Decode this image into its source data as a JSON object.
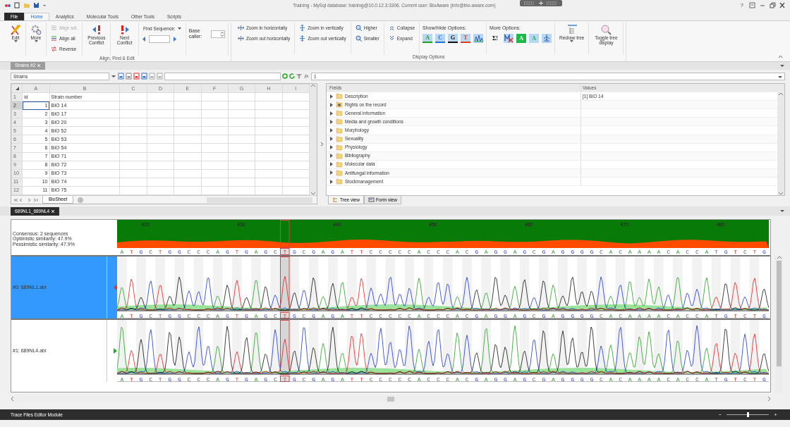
{
  "window": {
    "title": "Training - MySql database: training@10.0.12.3:3306. Current user: BioAware (info@bio-aware.com)",
    "help": "?"
  },
  "ribbon_tabs": [
    {
      "label": "File",
      "kind": "backstage",
      "selected": false
    },
    {
      "label": "Home",
      "kind": "tab",
      "selected": true
    },
    {
      "label": "Analytics",
      "kind": "tab",
      "selected": false
    },
    {
      "label": "Molecular Tools",
      "kind": "tab",
      "selected": false
    },
    {
      "label": "Other Tools",
      "kind": "tab",
      "selected": false
    },
    {
      "label": "Scripts",
      "kind": "tab",
      "selected": false
    }
  ],
  "ribbon": {
    "groups": [
      {
        "label": "Align, Find & Edit",
        "columns": [
          {
            "kind": "large",
            "label": "Edit",
            "menu": true
          },
          {
            "kind": "large",
            "label": "More",
            "menu": true
          },
          {
            "kind": "stack",
            "items": [
              {
                "label": "Align sel.",
                "disabled": true
              },
              {
                "label": "Align all",
                "disabled": false
              },
              {
                "label": "Reverse",
                "disabled": false
              }
            ]
          },
          {
            "kind": "large",
            "label": "Previous Conflict",
            "menu": false
          },
          {
            "kind": "large",
            "label": "Next Conflict",
            "menu": false
          },
          {
            "kind": "find",
            "label": "Find Sequence:"
          },
          {
            "kind": "spin",
            "label": "Base caller:"
          }
        ]
      },
      {
        "label": "Display Options",
        "columns": [
          {
            "kind": "stack",
            "items": [
              {
                "label": "Zoom in horizontally",
                "disabled": false
              },
              {
                "label": "Zoom out horizontally",
                "disabled": false
              }
            ]
          },
          {
            "kind": "stack",
            "items": [
              {
                "label": "Zoom in vertically",
                "disabled": false
              },
              {
                "label": "Zoom out vertically",
                "disabled": false
              }
            ]
          },
          {
            "kind": "stack",
            "items": [
              {
                "label": "Higher",
                "disabled": false
              },
              {
                "label": "Smaller",
                "disabled": false
              }
            ]
          },
          {
            "kind": "stack",
            "items": [
              {
                "label": "Collapse",
                "disabled": false
              },
              {
                "label": "Expand",
                "disabled": false
              }
            ]
          },
          {
            "kind": "toggles",
            "label": "Show/Hide Options:",
            "items": [
              {
                "kind": "letter",
                "label": "A",
                "color": "#22a022",
                "on": true
              },
              {
                "kind": "letter",
                "label": "C",
                "color": "#1e6fd9",
                "on": true
              },
              {
                "kind": "letter",
                "label": "G",
                "color": "#111111",
                "on": true
              },
              {
                "kind": "letter",
                "label": "T",
                "color": "#e0401a",
                "on": true
              },
              {
                "kind": "icon",
                "on": true
              }
            ]
          },
          {
            "kind": "toggles",
            "label": "More Options:",
            "items": [
              {
                "kind": "text",
                "label": "Σ!",
                "on": false
              },
              {
                "kind": "icon",
                "on": true
              },
              {
                "kind": "boxed",
                "label": "A",
                "on": false
              },
              {
                "kind": "tinted",
                "label": "A",
                "on": true
              },
              {
                "kind": "icon",
                "on": true
              }
            ]
          },
          {
            "kind": "large",
            "label": "Redraw tree",
            "menu": true
          },
          {
            "kind": "large",
            "label": "Toggle tree display",
            "menu": false
          }
        ]
      }
    ]
  },
  "sheet": {
    "tab": "Strains #2",
    "name_box": "Strains",
    "formula_label": "fx",
    "formula": "1",
    "columns": [
      "A",
      "B",
      "C",
      "D",
      "E",
      "F",
      "G",
      "H",
      "I"
    ],
    "rows": [
      {
        "number": "1",
        "kind": "header",
        "selected": false,
        "cells": [
          "id",
          "Strain number"
        ]
      },
      {
        "number": "2",
        "kind": "data",
        "selected": true,
        "cells": [
          "1",
          "BIO 14"
        ]
      },
      {
        "number": "3",
        "kind": "data",
        "selected": false,
        "cells": [
          "2",
          "BIO 17"
        ]
      },
      {
        "number": "4",
        "kind": "data",
        "selected": false,
        "cells": [
          "3",
          "BIO 20"
        ]
      },
      {
        "number": "5",
        "kind": "data",
        "selected": false,
        "cells": [
          "4",
          "BIO 52"
        ]
      },
      {
        "number": "6",
        "kind": "data",
        "selected": false,
        "cells": [
          "5",
          "BIO 53"
        ]
      },
      {
        "number": "7",
        "kind": "data",
        "selected": false,
        "cells": [
          "6",
          "BIO 54"
        ]
      },
      {
        "number": "8",
        "kind": "data",
        "selected": false,
        "cells": [
          "7",
          "BIO 71"
        ]
      },
      {
        "number": "9",
        "kind": "data",
        "selected": false,
        "cells": [
          "8",
          "BIO 72"
        ]
      },
      {
        "number": "10",
        "kind": "data",
        "selected": false,
        "cells": [
          "9",
          "BIO 73"
        ]
      },
      {
        "number": "11",
        "kind": "data",
        "selected": false,
        "cells": [
          "10",
          "BIO 74"
        ]
      },
      {
        "number": "12",
        "kind": "data",
        "selected": false,
        "cells": [
          "11",
          "BIO 75"
        ]
      }
    ],
    "sheet_tabs": [
      {
        "label": "BioSheet",
        "selected": true
      }
    ]
  },
  "fields": {
    "columns": [
      "Fields",
      "Values"
    ],
    "items": [
      {
        "name": "Description",
        "value": "[1] BIO 14",
        "kind": "folder",
        "expanded": false
      },
      {
        "name": "Rights on the record",
        "kind": "locked",
        "expanded": false
      },
      {
        "name": "General information",
        "kind": "folder",
        "expanded": false
      },
      {
        "name": "Media and growth conditions",
        "kind": "folder",
        "expanded": false
      },
      {
        "name": "Morphology",
        "kind": "folder",
        "expanded": false
      },
      {
        "name": "Sexuality",
        "kind": "folder",
        "expanded": false
      },
      {
        "name": "Physiology",
        "kind": "folder",
        "expanded": false
      },
      {
        "name": "Bibliography",
        "kind": "folder",
        "expanded": false
      },
      {
        "name": "Molecular data",
        "kind": "folder",
        "expanded": false
      },
      {
        "name": "Antifungal information",
        "kind": "folder",
        "expanded": false
      },
      {
        "name": "Stockmanagement",
        "kind": "folder",
        "expanded": false
      }
    ],
    "views": [
      {
        "label": "Tree view",
        "selected": true
      },
      {
        "label": "Form view",
        "selected": false
      }
    ]
  },
  "trace": {
    "tab": "689NL1_689NL4",
    "consensus": {
      "lines": [
        "Consensus: 2 sequences",
        "Optimistic similarity: 47.9%",
        "Pessimistic similarity: 47.9%"
      ],
      "ticks": [
        "420",
        "430",
        "440",
        "450",
        "460",
        "470",
        "480"
      ],
      "bases_before": "A T G C T G G C C C A G T G A G C",
      "marked": "T",
      "bases_after": "G C G A G A T T C C C C C A C C C A C G A G G A G C G A G G G G C A C A A A A C A C C A T G T C T G"
    },
    "tracks": [
      {
        "name": "#0: 689NL1.abi",
        "selected": true,
        "kind": "reverse",
        "bases_before": "A T G C T G G C C C A G T G A G C",
        "marked": "T",
        "bases_after": "G C G A G A T T C C C C C A C C C A C G A G G A G C G A G G G G C A C A A A A C A C C A T G T C T G"
      },
      {
        "name": "#1: 689NL4.abi",
        "selected": false,
        "kind": "forward",
        "bases_before": "A T G C T G G C C C A G T G A G C",
        "marked": "T",
        "bases_after": "G C G A G A T T C C C C C A C C C A C G A G G A G C G A G G G G C A C A A A A C A C C A T G T C T G"
      }
    ]
  },
  "status_bar": {
    "label": "Trace Files Editor Module",
    "zoom_out": "−",
    "zoom_in": "+",
    "zoom": {
      "level": 0.5
    }
  }
}
